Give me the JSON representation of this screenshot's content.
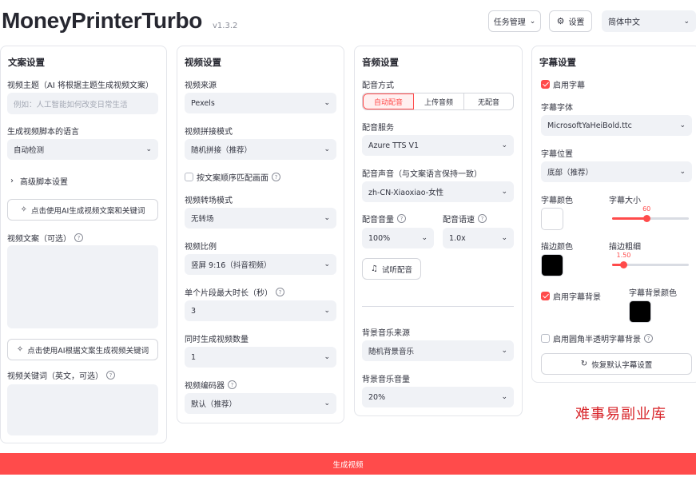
{
  "app": {
    "title": "MoneyPrinterTurbo",
    "version": "v1.3.2"
  },
  "header": {
    "task_manager": "任务管理",
    "settings": "设置",
    "language": "简体中文"
  },
  "script_panel": {
    "title": "文案设置",
    "subject_label": "视频主题（AI 将根据主题生成视频文案）",
    "subject_placeholder": "例如：人工智能如何改变日常生活",
    "language_label": "生成视频脚本的语言",
    "language_value": "自动检测",
    "advanced": "高级脚本设置",
    "gen_script_button": "点击使用AI生成视频文案和关键词",
    "script_label": "视频文案（可选）",
    "gen_keywords_button": "点击使用AI根据文案生成视频关键词",
    "keywords_label": "视频关键词（英文，可选）"
  },
  "video_panel": {
    "title": "视频设置",
    "source_label": "视频来源",
    "source_value": "Pexels",
    "concat_label": "视频拼接模式",
    "concat_value": "随机拼接（推荐）",
    "match_order_label": "按文案顺序匹配画面",
    "transition_label": "视频转场模式",
    "transition_value": "无转场",
    "aspect_label": "视频比例",
    "aspect_value": "竖屏 9:16（抖音视频）",
    "clip_duration_label": "单个片段最大时长（秒）",
    "clip_duration_value": "3",
    "count_label": "同时生成视频数量",
    "count_value": "1",
    "codec_label": "视频编码器",
    "codec_value": "默认（推荐）"
  },
  "audio_panel": {
    "title": "音频设置",
    "voice_mode_label": "配音方式",
    "voice_modes": [
      "自动配音",
      "上传音频",
      "无配音"
    ],
    "service_label": "配音服务",
    "service_value": "Azure TTS V1",
    "voice_label": "配音声音（与文案语言保持一致）",
    "voice_value": "zh-CN-Xiaoxiao-女性",
    "volume_label": "配音音量",
    "volume_value": "100%",
    "rate_label": "配音语速",
    "rate_value": "1.0x",
    "preview_button": "试听配音",
    "bgm_source_label": "背景音乐来源",
    "bgm_source_value": "随机背景音乐",
    "bgm_volume_label": "背景音乐音量",
    "bgm_volume_value": "20%"
  },
  "subtitle_panel": {
    "title": "字幕设置",
    "enable_label": "启用字幕",
    "font_label": "字幕字体",
    "font_value": "MicrosoftYaHeiBold.ttc",
    "position_label": "字幕位置",
    "position_value": "底部（推荐）",
    "color_label": "字幕颜色",
    "size_label": "字幕大小",
    "size_value": "60",
    "size_fraction": 0.45,
    "stroke_color_label": "描边颜色",
    "stroke_width_label": "描边粗细",
    "stroke_width_value": "1.50",
    "stroke_fraction": 0.15,
    "bg_enable_label": "启用字幕背景",
    "bg_color_label": "字幕背景颜色",
    "rounded_label": "启用圆角半透明字幕背景",
    "reset_button": "恢复默认字幕设置",
    "colors": {
      "font": "#ffffff",
      "stroke": "#000000",
      "background": "#000000"
    }
  },
  "actions": {
    "generate": "生成视频"
  },
  "watermark": "难事易副业库"
}
